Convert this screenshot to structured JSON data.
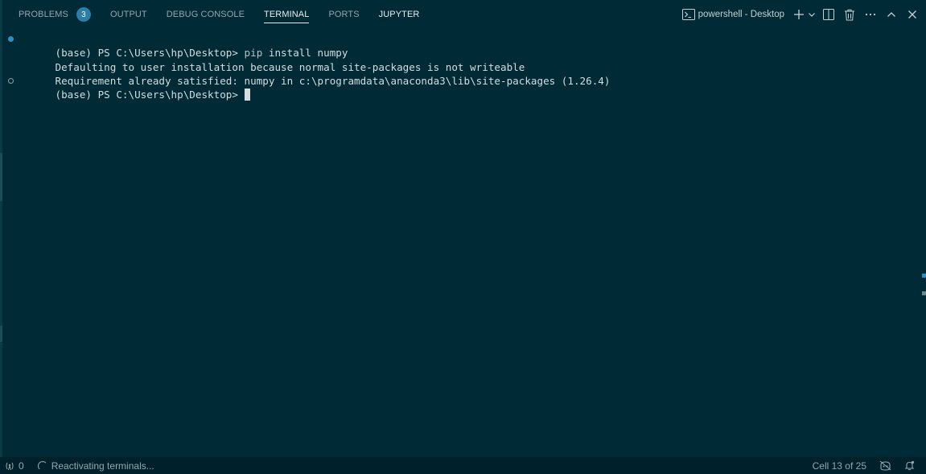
{
  "panel_tabs": [
    {
      "label": "PROBLEMS",
      "badge": "3"
    },
    {
      "label": "OUTPUT"
    },
    {
      "label": "DEBUG CONSOLE"
    },
    {
      "label": "TERMINAL",
      "active": true
    },
    {
      "label": "PORTS"
    },
    {
      "label": "JUPYTER"
    }
  ],
  "actions": {
    "shell_label": "powershell - Desktop",
    "icons": [
      "terminal-icon",
      "plus-icon",
      "chevron-down-icon",
      "split-icon",
      "trash-icon",
      "ellipsis-icon",
      "chevron-up-icon",
      "close-icon"
    ]
  },
  "terminal": {
    "lines": [
      {
        "prompt": "(base) PS C:\\Users\\hp\\Desktop> ",
        "cmd_name": "pip",
        "cmd_args": " install numpy"
      },
      {
        "text": "Defaulting to user installation because normal site-packages is not writeable"
      },
      {
        "text": "Requirement already satisfied: numpy in c:\\programdata\\anaconda3\\lib\\site-packages (1.26.4)"
      },
      {
        "prompt": "(base) PS C:\\Users\\hp\\Desktop> "
      }
    ]
  },
  "statusbar": {
    "ports_count": "0",
    "activity": "Reactivating terminals...",
    "cell": "Cell 13 of 25"
  },
  "colors": {
    "background": "#002b36",
    "statusbar": "#00212b",
    "badge": "#2a7ea8",
    "decoration_success": "#2a8fc7"
  }
}
